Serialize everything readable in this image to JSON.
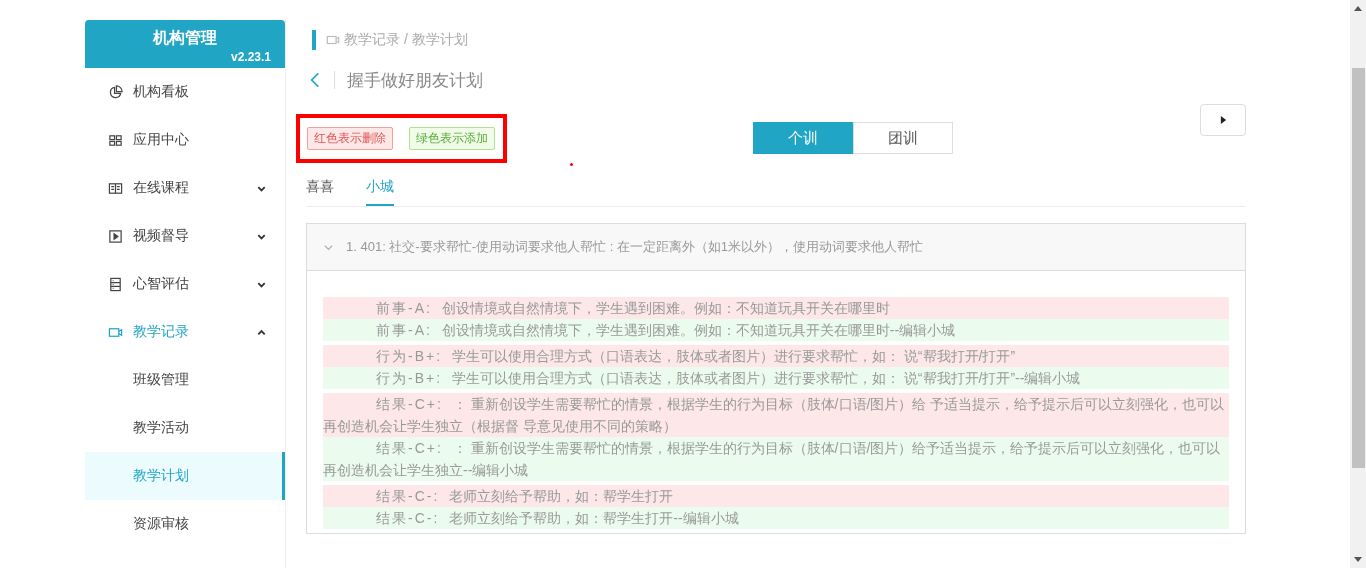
{
  "sidebar": {
    "title": "机构管理",
    "version": "v2.23.1",
    "items": [
      {
        "label": "机构看板",
        "kind": "link",
        "selected": false
      },
      {
        "label": "应用中心",
        "kind": "link",
        "selected": false
      },
      {
        "label": "在线课程",
        "kind": "menu",
        "selected": false,
        "expanded": false
      },
      {
        "label": "视频督导",
        "kind": "menu",
        "selected": false,
        "expanded": false
      },
      {
        "label": "心智评估",
        "kind": "menu",
        "selected": false,
        "expanded": false
      },
      {
        "label": "教学记录",
        "kind": "menu",
        "selected": true,
        "expanded": true,
        "children": [
          {
            "label": "班级管理",
            "selected": false
          },
          {
            "label": "教学活动",
            "selected": false
          },
          {
            "label": "教学计划",
            "selected": true
          },
          {
            "label": "资源审核",
            "selected": false
          }
        ]
      }
    ]
  },
  "breadcrumb": "教学记录 / 教学计划",
  "page_title": "握手做好朋友计划",
  "legend": [
    {
      "label": "红色表示删除",
      "kind": "removed"
    },
    {
      "label": "绿色表示添加",
      "kind": "added"
    }
  ],
  "modes": [
    {
      "label": "个训",
      "selected": true
    },
    {
      "label": "团训",
      "selected": false
    }
  ],
  "tabs": [
    {
      "label": "喜喜",
      "selected": false
    },
    {
      "label": "小城",
      "selected": true
    }
  ],
  "panel": {
    "title": "1. 401: 社交-要求帮忙-使用动词要求他人帮忙 : 在一定距离外（如1米以外），使用动词要求他人帮忙",
    "expanded": true,
    "groups": [
      {
        "rows": [
          {
            "kind": "removed",
            "label": "前事-A:",
            "text": "创设情境或自然情境下，学生遇到困难。例如：不知道玩具开关在哪里时"
          },
          {
            "kind": "added",
            "label": "前事-A:",
            "text": "创设情境或自然情境下，学生遇到困难。例如：不知道玩具开关在哪里时--编辑小城"
          }
        ]
      },
      {
        "rows": [
          {
            "kind": "removed",
            "label": "行为-B+:",
            "text": "学生可以使用合理方式（口语表达，肢体或者图片）进行要求帮忙，如： 说“帮我打开/打开”"
          },
          {
            "kind": "added",
            "label": "行为-B+:",
            "text": "学生可以使用合理方式（口语表达，肢体或者图片）进行要求帮忙，如： 说“帮我打开/打开”--编辑小城"
          }
        ]
      },
      {
        "rows": [
          {
            "kind": "removed",
            "label": "结果-C+:",
            "text": "： 重新创设学生需要帮忙的情景，根据学生的行为目标（肢体/口语/图片）给 予适当提示，给予提示后可以立刻强化，也可以再创造机会让学生独立（根据督 导意见使用不同的策略）"
          },
          {
            "kind": "added",
            "label": "结果-C+:",
            "text": "： 重新创设学生需要帮忙的情景，根据学生的行为目标（肢体/口语/图片）给予适当提示，给予提示后可以立刻强化，也可以再创造机会让学生独立--编辑小城"
          }
        ]
      },
      {
        "rows": [
          {
            "kind": "removed",
            "label": "结果-C-:",
            "text": "老师立刻给予帮助，如：帮学生打开"
          },
          {
            "kind": "added",
            "label": "结果-C-:",
            "text": "老师立刻给予帮助，如：帮学生打开--编辑小城"
          }
        ]
      }
    ]
  }
}
